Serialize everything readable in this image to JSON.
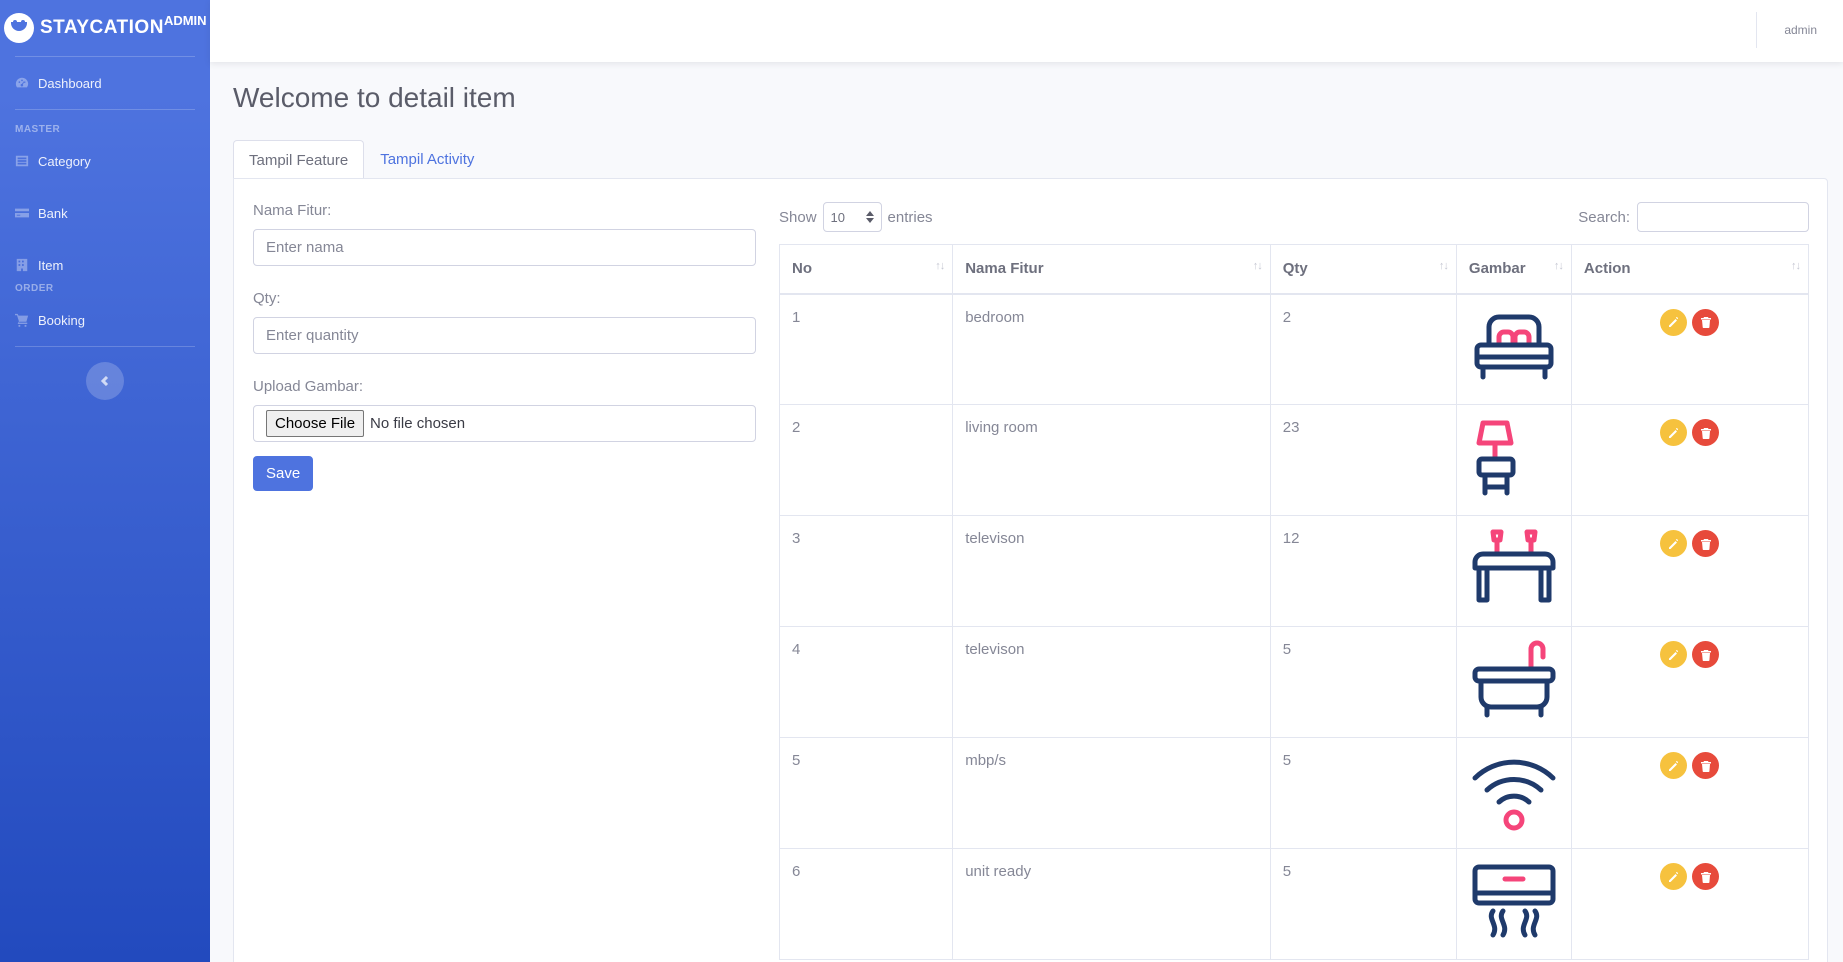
{
  "brand": {
    "name": "STAYCATION",
    "sup": "ADMIN"
  },
  "sidebar": {
    "dashboard": "Dashboard",
    "heading_master": "MASTER",
    "category": "Category",
    "bank": "Bank",
    "item": "Item",
    "heading_order": "ORDER",
    "booking": "Booking"
  },
  "topbar": {
    "user": "admin"
  },
  "page": {
    "title": "Welcome to detail item"
  },
  "tabs": {
    "feature": "Tampil Feature",
    "activity": "Tampil Activity"
  },
  "form": {
    "name_label": "Nama Fitur:",
    "name_placeholder": "Enter nama",
    "qty_label": "Qty:",
    "qty_placeholder": "Enter quantity",
    "upload_label": "Upload Gambar:",
    "choose_file": "Choose File",
    "no_file": "No file chosen",
    "save": "Save"
  },
  "datatable": {
    "show": "Show",
    "length": "10",
    "entries": "entries",
    "search_label": "Search:",
    "columns": [
      "No",
      "Nama Fitur",
      "Qty",
      "Gambar",
      "Action"
    ],
    "rows": [
      {
        "no": "1",
        "name": "bedroom",
        "qty": "2",
        "icon": "bed-icon"
      },
      {
        "no": "2",
        "name": "living room",
        "qty": "23",
        "icon": "lamp-icon"
      },
      {
        "no": "3",
        "name": "televison",
        "qty": "12",
        "icon": "table-icon"
      },
      {
        "no": "4",
        "name": "televison",
        "qty": "5",
        "icon": "bathtub-icon"
      },
      {
        "no": "5",
        "name": "mbp/s",
        "qty": "5",
        "icon": "wifi-icon"
      },
      {
        "no": "6",
        "name": "unit ready",
        "qty": "5",
        "icon": "air-conditioner-icon"
      }
    ]
  },
  "colors": {
    "primary": "#4e73df",
    "navy": "#1f3a6b",
    "pink": "#f5457a",
    "warning": "#f6c23e",
    "danger": "#e74a3b"
  }
}
